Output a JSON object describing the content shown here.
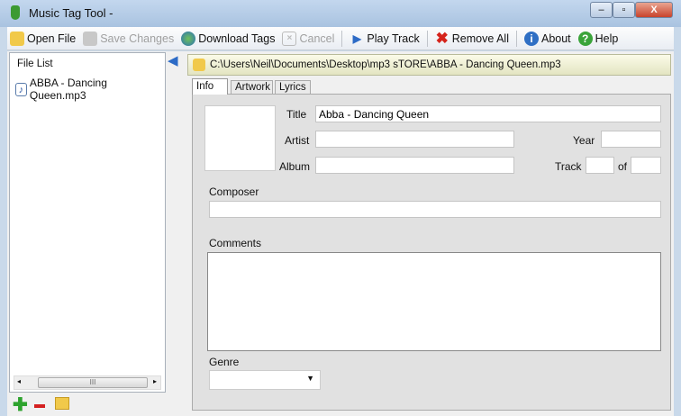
{
  "window": {
    "title": "Music Tag Tool -",
    "minimize": "–",
    "maximize": "▫",
    "close": "X"
  },
  "toolbar": [
    {
      "label": "Open File",
      "icon": "folder-icon",
      "enabled": true
    },
    {
      "label": "Save Changes",
      "icon": "save-icon",
      "enabled": false
    },
    {
      "label": "Download Tags",
      "icon": "globe-icon",
      "enabled": true
    },
    {
      "label": "Cancel",
      "icon": "cancel-icon",
      "enabled": false
    },
    {
      "label": "Play Track",
      "icon": "play-icon",
      "enabled": true
    },
    {
      "label": "Remove All",
      "icon": "red-x-icon",
      "enabled": true
    },
    {
      "label": "About",
      "icon": "info-icon",
      "enabled": true
    },
    {
      "label": "Help",
      "icon": "help-icon",
      "enabled": true
    }
  ],
  "file_list": {
    "header": "File List",
    "items": [
      "ABBA - Dancing Queen.mp3"
    ],
    "scroll_grip": "III"
  },
  "path": "C:\\Users\\Neil\\Documents\\Desktop\\mp3 sTORE\\ABBA - Dancing Queen.mp3",
  "tabs": [
    "Info",
    "Artwork",
    "Lyrics"
  ],
  "form": {
    "title_label": "Title",
    "title_value": "Abba - Dancing Queen",
    "artist_label": "Artist",
    "artist_value": "",
    "year_label": "Year",
    "year_value": "",
    "album_label": "Album",
    "album_value": "",
    "track_label": "Track",
    "track_value": "",
    "of_label": "of",
    "track_total": "",
    "composer_label": "Composer",
    "composer_value": "",
    "comments_label": "Comments",
    "comments_value": "",
    "genre_label": "Genre",
    "genre_value": ""
  }
}
